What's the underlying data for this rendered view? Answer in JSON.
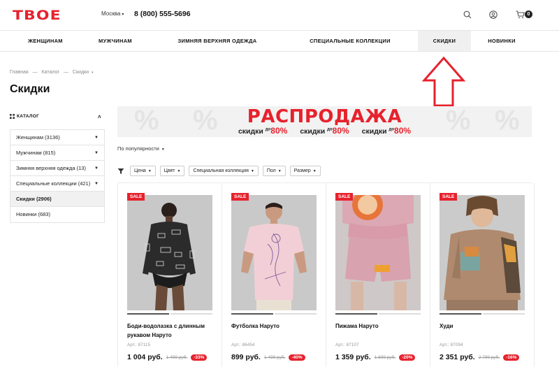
{
  "header": {
    "logo": "ТВОЕ",
    "city": "Москва",
    "phone": "8 (800) 555-5696",
    "cart_count": "0",
    "icons": [
      "search-icon",
      "user-icon",
      "cart-icon"
    ]
  },
  "nav": {
    "items": [
      {
        "label": "ЖЕНЩИНАМ"
      },
      {
        "label": "МУЖЧИНАМ"
      },
      {
        "label": "ЗИМНЯЯ ВЕРХНЯЯ ОДЕЖДА"
      },
      {
        "label": "СПЕЦИАЛЬНЫЕ КОЛЛЕКЦИИ"
      },
      {
        "label": "СКИДКИ"
      },
      {
        "label": "НОВИНКИ"
      }
    ],
    "active": "СКИДКИ"
  },
  "breadcrumb": [
    "Главная",
    "—",
    "Каталог",
    "—",
    "Скидки"
  ],
  "page_title": "Скидки",
  "sidebar": {
    "heading": "КАТАЛОГ",
    "items": [
      {
        "label": "Женщинам (3136)"
      },
      {
        "label": "Мужчинам (815)"
      },
      {
        "label": "Зимняя верхняя одежда (13)"
      },
      {
        "label": "Специальные коллекции (421)"
      },
      {
        "label": "Скидки (2906)"
      },
      {
        "label": "Новинки (683)"
      }
    ]
  },
  "banner": {
    "title": "РАСПРОДАЖА",
    "sub_prefix": "скидки",
    "sub_upto": "до",
    "sub_value": "80%"
  },
  "sort": {
    "label": "По популярности"
  },
  "filters": [
    "Цена",
    "Цвет",
    "Специальная коллекция",
    "Пол",
    "Размер"
  ],
  "products": [
    {
      "badge": "SALE",
      "name": "Боди-водолазка с длинным рукавом Наруто",
      "article": "Арт.: 87115",
      "price": "1 004 руб.",
      "old_price": "1 499 руб.",
      "discount": "-33%"
    },
    {
      "badge": "SALE",
      "name": "Футболка Наруто",
      "article": "Арт.: 86454",
      "price": "899 руб.",
      "old_price": "1 499 руб.",
      "discount": "-40%"
    },
    {
      "badge": "SALE",
      "name": "Пижама Наруто",
      "article": "Арт.: 87107",
      "price": "1 359 руб.",
      "old_price": "1 699 руб.",
      "discount": "-20%"
    },
    {
      "badge": "SALE",
      "name": "Худи",
      "article": "Арт.: 87094",
      "price": "2 351 руб.",
      "old_price": "2 799 руб.",
      "discount": "-16%"
    }
  ],
  "colors": {
    "brand": "#e6222d",
    "text": "#111111"
  }
}
